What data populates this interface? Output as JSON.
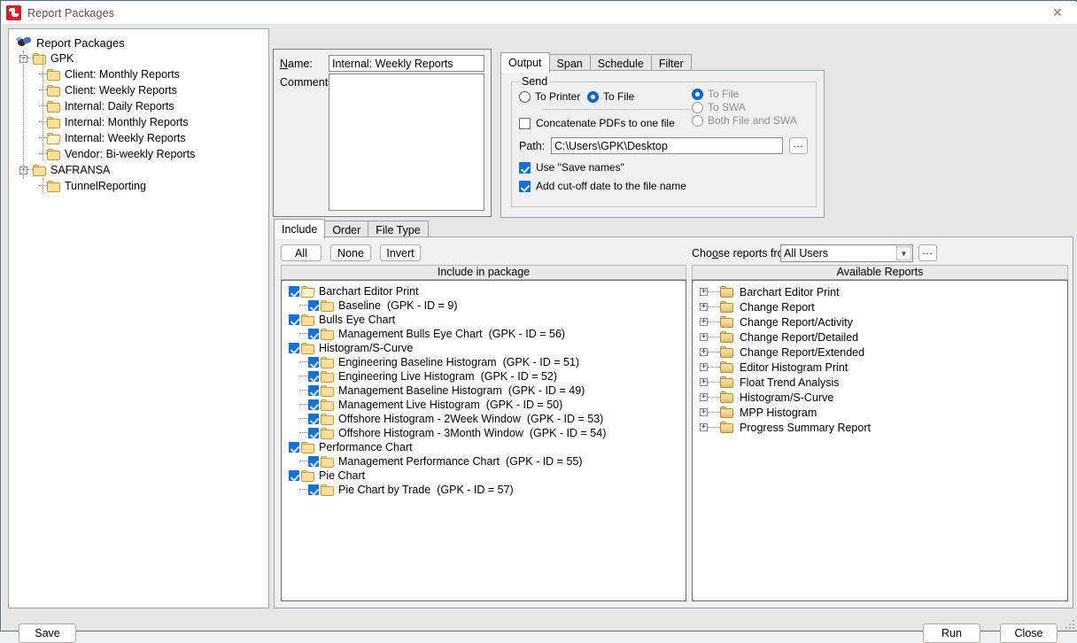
{
  "window": {
    "title": "Report Packages",
    "icon": "app-icon",
    "close_label": "✕"
  },
  "left_tree": {
    "root": {
      "label": "Report Packages",
      "icon": "report-packages-icon"
    },
    "nodes": [
      {
        "label": "GPK",
        "level": 1,
        "expander": "−",
        "icon": "folder-icon"
      },
      {
        "label": "Client: Monthly Reports",
        "level": 2,
        "icon": "folder-icon"
      },
      {
        "label": "Client: Weekly Reports",
        "level": 2,
        "icon": "folder-icon"
      },
      {
        "label": "Internal: Daily Reports",
        "level": 2,
        "icon": "folder-icon"
      },
      {
        "label": "Internal: Monthly Reports",
        "level": 2,
        "icon": "folder-icon"
      },
      {
        "label": "Internal: Weekly Reports",
        "level": 2,
        "icon": "folder-open-icon",
        "selected": true
      },
      {
        "label": "Vendor: Bi-weekly Reports",
        "level": 2,
        "icon": "folder-icon"
      },
      {
        "label": "SAFRANSA",
        "level": 1,
        "expander": "−",
        "icon": "folder-icon"
      },
      {
        "label": "TunnelReporting",
        "level": 2,
        "icon": "folder-icon"
      }
    ]
  },
  "details": {
    "name_label": "Name:",
    "name_accel": "N",
    "name_value": "Internal: Weekly Reports",
    "comments_label": "Comments:",
    "comments_value": ""
  },
  "top_tabs": {
    "items": [
      {
        "label": "Output",
        "active": true
      },
      {
        "label": "Span",
        "active": false
      },
      {
        "label": "Schedule",
        "active": false
      },
      {
        "label": "Filter",
        "active": false
      }
    ]
  },
  "output": {
    "group_title": "Send",
    "send_mode": [
      {
        "label": "To Printer",
        "selected": false
      },
      {
        "label": "To File",
        "selected": true
      }
    ],
    "destination": [
      {
        "label": "To File",
        "selected": true,
        "disabled": true
      },
      {
        "label": "To SWA",
        "selected": false,
        "disabled": true
      },
      {
        "label": "Both File and SWA",
        "selected": false,
        "disabled": true
      }
    ],
    "concatenate": {
      "label": "Concatenate PDFs to one file",
      "checked": false
    },
    "path_label": "Path:",
    "path_value": "C:\\Users\\GPK\\Desktop",
    "path_browse_label": "...",
    "use_save_names": {
      "label": "Use \"Save names\"",
      "checked": true
    },
    "add_cutoff_date": {
      "label": "Add cut-off date to the file name",
      "checked": true
    }
  },
  "bottom_tabs": {
    "items": [
      {
        "label": "Include",
        "active": true
      },
      {
        "label": "Order",
        "active": false
      },
      {
        "label": "File Type",
        "active": false
      }
    ]
  },
  "selection_buttons": [
    {
      "label": "All"
    },
    {
      "label": "None"
    },
    {
      "label": "Invert"
    }
  ],
  "include_panel": {
    "header": "Include in package",
    "rows": [
      {
        "label": "Barchart Editor Print",
        "detail": "",
        "level": 0,
        "checked": true,
        "icon": "folder-open-icon"
      },
      {
        "label": "Baseline",
        "detail": "(GPK - ID = 9)",
        "level": 1,
        "checked": true,
        "icon": "folder-icon"
      },
      {
        "label": "Bulls Eye Chart",
        "detail": "",
        "level": 0,
        "checked": true,
        "icon": "folder-icon"
      },
      {
        "label": "Management Bulls Eye Chart",
        "detail": "(GPK - ID = 56)",
        "level": 1,
        "checked": true,
        "icon": "folder-icon"
      },
      {
        "label": "Histogram/S-Curve",
        "detail": "",
        "level": 0,
        "checked": true,
        "icon": "folder-icon"
      },
      {
        "label": "Engineering Baseline Histogram",
        "detail": "(GPK - ID = 51)",
        "level": 1,
        "checked": true,
        "icon": "folder-icon"
      },
      {
        "label": "Engineering Live Histogram",
        "detail": "(GPK - ID = 52)",
        "level": 1,
        "checked": true,
        "icon": "folder-icon"
      },
      {
        "label": "Management Baseline Histogram",
        "detail": "(GPK - ID = 49)",
        "level": 1,
        "checked": true,
        "icon": "folder-icon"
      },
      {
        "label": "Management Live Histogram",
        "detail": "(GPK - ID = 50)",
        "level": 1,
        "checked": true,
        "icon": "folder-icon"
      },
      {
        "label": "Offshore Histogram - 2Week Window",
        "detail": "(GPK - ID = 53)",
        "level": 1,
        "checked": true,
        "icon": "folder-icon"
      },
      {
        "label": "Offshore Histogram - 3Month Window",
        "detail": "(GPK - ID = 54)",
        "level": 1,
        "checked": true,
        "icon": "folder-icon"
      },
      {
        "label": "Performance Chart",
        "detail": "",
        "level": 0,
        "checked": true,
        "icon": "folder-icon"
      },
      {
        "label": "Management Performance Chart",
        "detail": "(GPK - ID = 55)",
        "level": 1,
        "checked": true,
        "icon": "folder-icon"
      },
      {
        "label": "Pie Chart",
        "detail": "",
        "level": 0,
        "checked": true,
        "icon": "folder-icon"
      },
      {
        "label": "Pie Chart by Trade",
        "detail": "(GPK - ID = 57)",
        "level": 1,
        "checked": true,
        "icon": "folder-icon"
      }
    ]
  },
  "available_panel": {
    "chooser_label": "Choose reports from:",
    "chooser_accel": "o",
    "chooser_value": "All Users",
    "chooser_browse_label": "...",
    "header": "Available Reports",
    "rows": [
      {
        "label": "Barchart Editor Print",
        "expander": "+"
      },
      {
        "label": "Change Report",
        "expander": "+"
      },
      {
        "label": "Change Report/Activity",
        "expander": "+"
      },
      {
        "label": "Change Report/Detailed",
        "expander": "+"
      },
      {
        "label": "Change Report/Extended",
        "expander": "+"
      },
      {
        "label": "Editor Histogram Print",
        "expander": "+"
      },
      {
        "label": "Float Trend Analysis",
        "expander": "+"
      },
      {
        "label": "Histogram/S-Curve",
        "expander": "+"
      },
      {
        "label": "MPP Histogram",
        "expander": "+"
      },
      {
        "label": "Progress Summary Report",
        "expander": "+"
      }
    ]
  },
  "footer": {
    "save_label": "Save",
    "run_label": "Run",
    "close_label": "Close"
  },
  "colors": {
    "accent": "#0d6ad6",
    "check": "#1273d2",
    "folder": "#fcdf9a",
    "folder_border": "#c59a3b",
    "window_border": "#5b6d78",
    "brand_red": "#e01b22"
  }
}
